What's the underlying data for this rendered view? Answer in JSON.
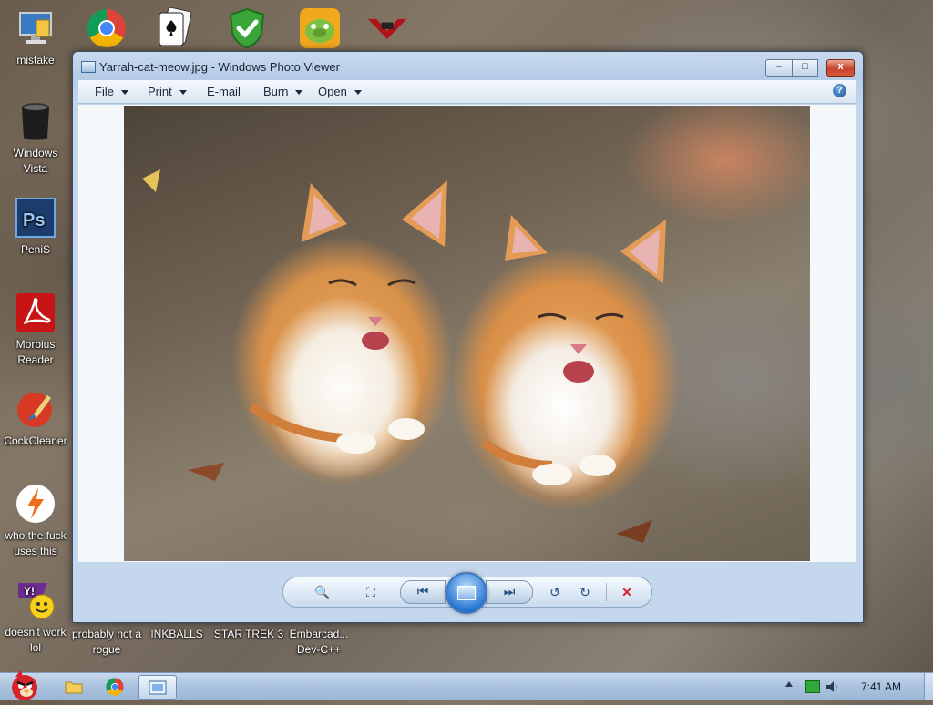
{
  "desktop": {
    "icons_left": [
      {
        "label": "mistake",
        "icon": "computer-monitor-icon"
      },
      {
        "label": "Windows Vista",
        "icon": "trash-bin-icon"
      },
      {
        "label": "PeniS",
        "icon": "photoshop-icon"
      },
      {
        "label": "Morbius Reader",
        "icon": "pdf-reader-icon"
      },
      {
        "label": "CockCleaner",
        "icon": "cleaner-brush-icon"
      },
      {
        "label": "who the fuck uses this",
        "icon": "lightning-app-icon"
      },
      {
        "label": "doesn't work lol",
        "icon": "yahoo-messenger-icon"
      }
    ],
    "icons_bottom": [
      {
        "label": "probably not a rogue"
      },
      {
        "label": "INKBALLS"
      },
      {
        "label": "STAR TREK 3"
      },
      {
        "label": "Embarcad... Dev-C++"
      }
    ],
    "icons_top": [
      {
        "icon": "chrome-icon"
      },
      {
        "icon": "solitaire-cards-icon"
      },
      {
        "icon": "security-shield-icon"
      },
      {
        "icon": "bad-piggies-icon"
      },
      {
        "icon": "brand-logo-icon"
      }
    ]
  },
  "window": {
    "title": "Yarrah-cat-meow.jpg - Windows Photo Viewer",
    "menu": [
      {
        "label": "File",
        "dropdown": true
      },
      {
        "label": "Print",
        "dropdown": true
      },
      {
        "label": "E-mail",
        "dropdown": false
      },
      {
        "label": "Burn",
        "dropdown": true
      },
      {
        "label": "Open",
        "dropdown": true
      }
    ],
    "help": "?",
    "controls": {
      "minimize": "–",
      "maximize": "□",
      "close": "x"
    }
  },
  "toolbar": {
    "zoom": "🔍",
    "fit": "⛶",
    "prev": "⏮",
    "next": "⏭",
    "rotate_ccw": "↺",
    "rotate_cw": "↻",
    "delete": "✕"
  },
  "taskbar": {
    "clock": "7:41 AM"
  },
  "colors": {
    "accent": "#2b78d2",
    "close_red": "#c8432b",
    "delete_red": "#d0232a"
  }
}
